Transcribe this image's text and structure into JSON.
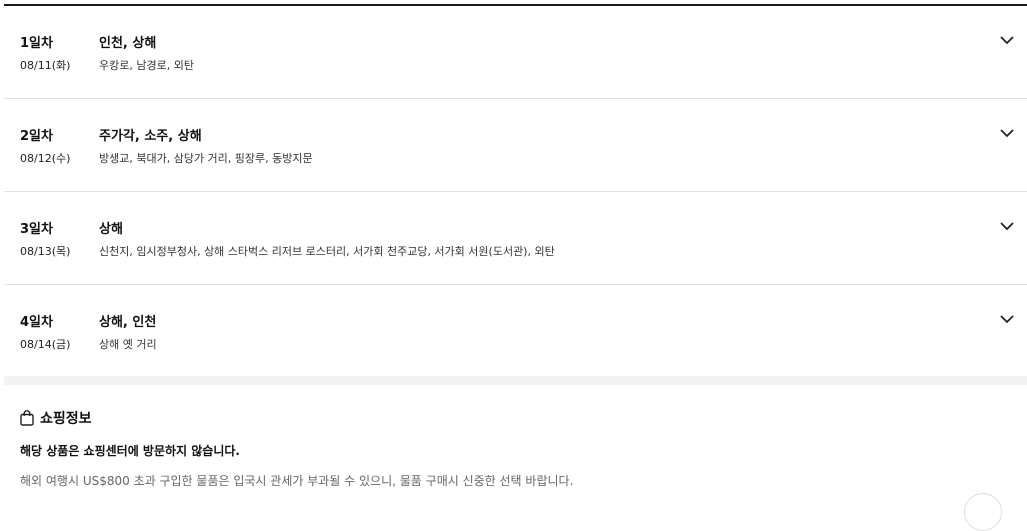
{
  "itinerary": {
    "days": [
      {
        "day": "1일차",
        "date": "08/11(화)",
        "cities": "인천, 상해",
        "spots": "우캉로, 남경로, 외탄"
      },
      {
        "day": "2일차",
        "date": "08/12(수)",
        "cities": "주가각, 소주, 상해",
        "spots": "방생교, 북대가, 삼당가 거리, 핑장루, 동방지문"
      },
      {
        "day": "3일차",
        "date": "08/13(목)",
        "cities": "상해",
        "spots": "신천지, 임시정부청사, 상해 스타벅스 리저브 로스터리, 서가회 천주교당, 서가회 서원(도서관), 외탄"
      },
      {
        "day": "4일차",
        "date": "08/14(금)",
        "cities": "상해, 인천",
        "spots": "상해 옛 거리"
      }
    ],
    "expand_icon": "chevron-down-icon"
  },
  "shopping": {
    "icon": "shopping-bag-icon",
    "title": "쇼핑정보",
    "notice": "해당 상품은 쇼핑센터에 방문하지 않습니다.",
    "description": "해외 여행시 US$800 초과 구입한 물품은 입국시 관세가 부과될 수 있으니, 물품 구매시 신중한 선택 바랍니다."
  }
}
